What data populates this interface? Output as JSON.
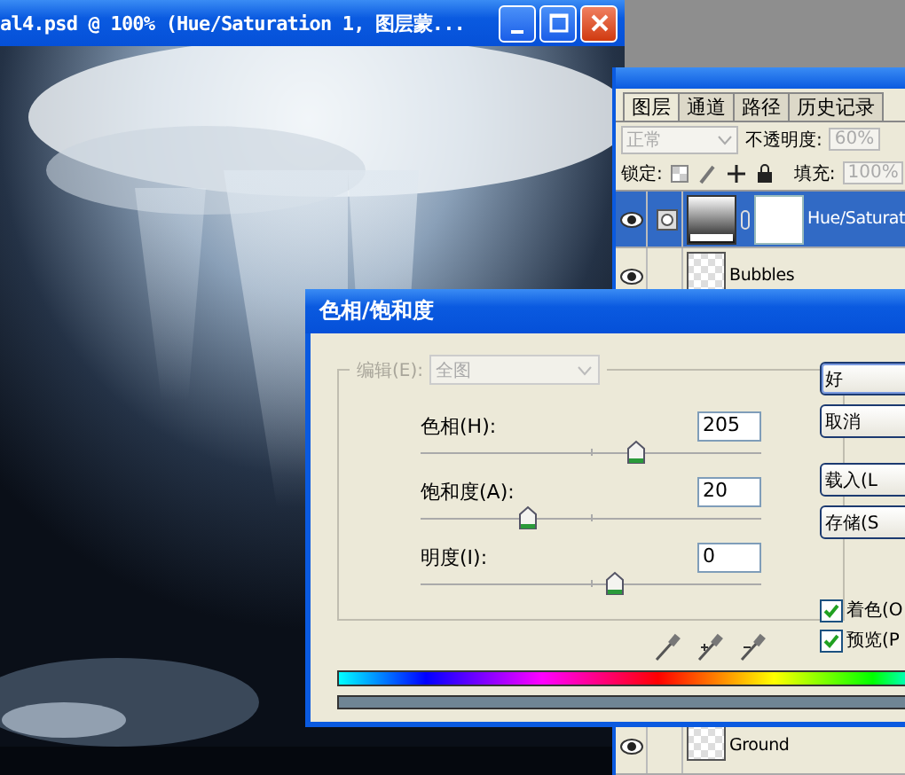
{
  "document_window": {
    "title": "al4.psd @ 100% (Hue/Saturation 1, 图层蒙..."
  },
  "layers_panel": {
    "tabs": [
      {
        "label": "图层",
        "selected": true
      },
      {
        "label": "通道",
        "selected": false
      },
      {
        "label": "路径",
        "selected": false
      },
      {
        "label": "历史记录",
        "selected": false
      }
    ],
    "blend_mode": {
      "value": "正常",
      "disabled": true
    },
    "opacity": {
      "label": "不透明度:",
      "value": "60%",
      "disabled": true
    },
    "lock_label": "锁定:",
    "fill": {
      "label": "填充:",
      "value": "100%",
      "disabled": true
    },
    "layers": [
      {
        "name": "Hue/Saturat",
        "kind": "adjustment",
        "visible": true,
        "selected": true
      },
      {
        "name": "Bubbles",
        "kind": "pixel",
        "visible": true,
        "selected": false
      },
      {
        "name": "Ground",
        "kind": "pixel",
        "visible": true,
        "selected": false
      }
    ]
  },
  "dialog": {
    "title": "色相/饱和度",
    "edit": {
      "label": "编辑(E):",
      "value": "全图",
      "disabled": true
    },
    "sliders": [
      {
        "label": "色相(H):",
        "value": "205",
        "level": 0.63
      },
      {
        "label": "饱和度(A):",
        "value": "20",
        "level": 0.31
      },
      {
        "label": "明度(I):",
        "value": "0",
        "level": 0.57
      }
    ],
    "buttons": [
      {
        "label": "好",
        "default": true
      },
      {
        "label": "取消",
        "default": false
      },
      {
        "label": "载入(L",
        "default": false
      },
      {
        "label": "存储(S",
        "default": false
      }
    ],
    "checkboxes": [
      {
        "label": "着色(O",
        "checked": true
      },
      {
        "label": "预览(P",
        "checked": true
      }
    ]
  }
}
